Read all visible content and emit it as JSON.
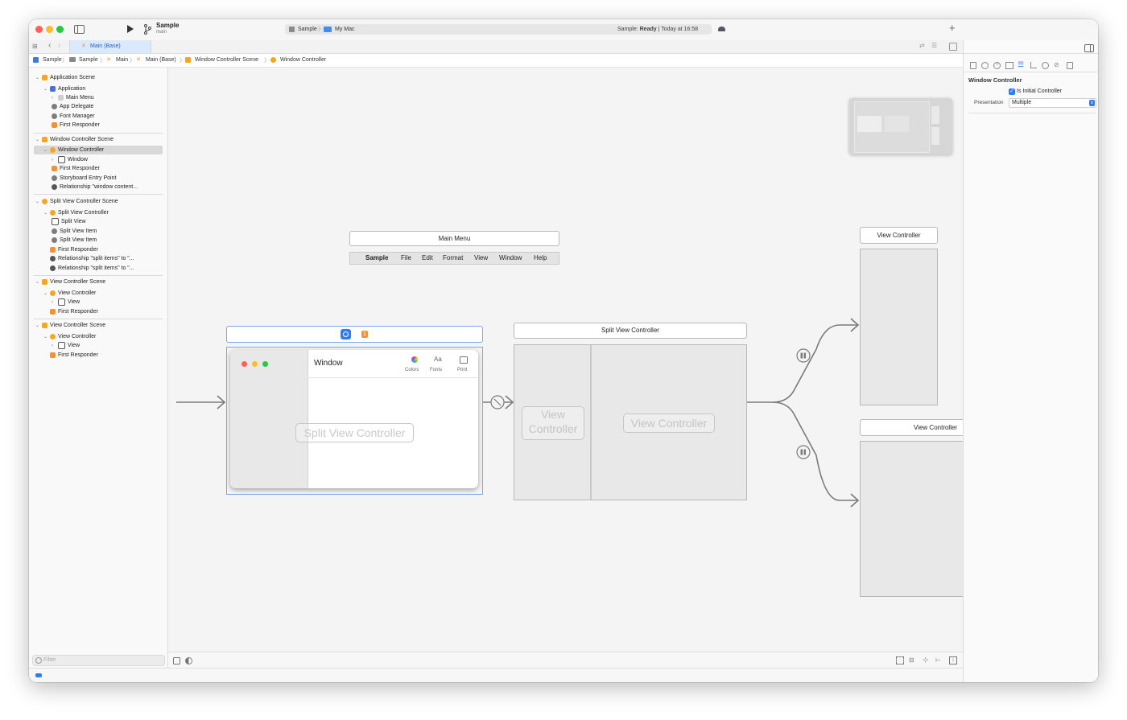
{
  "toolbar": {
    "project_name": "Sample",
    "branch": "main",
    "scheme": "Sample",
    "destination": "My Mac",
    "status_prefix": "Sample: ",
    "status_state": "Ready",
    "status_time": " | Today at 16:58"
  },
  "tabs": {
    "active_tab": "Main (Base)"
  },
  "jumpbar": [
    "Sample",
    "Sample",
    "Main",
    "Main (Base)",
    "Window Controller Scene",
    "Window Controller"
  ],
  "navigator": {
    "filter_placeholder": "Filter",
    "scenes": [
      {
        "title": "Application Scene",
        "items": [
          "Application",
          "Main Menu",
          "App Delegate",
          "Font Manager",
          "First Responder"
        ]
      },
      {
        "title": "Window Controller Scene",
        "items": [
          "Window Controller",
          "Window",
          "First Responder",
          "Storyboard Entry Point",
          "Relationship \"window content..."
        ]
      },
      {
        "title": "Split View Controller Scene",
        "items": [
          "Split View Controller",
          "Split View",
          "Split View Item",
          "Split View Item",
          "First Responder",
          "Relationship \"split items\" to \"...",
          "Relationship \"split items\" to \"..."
        ]
      },
      {
        "title": "View Controller Scene",
        "items": [
          "View Controller",
          "View",
          "First Responder"
        ]
      },
      {
        "title": "View Controller Scene",
        "items": [
          "View Controller",
          "View",
          "First Responder"
        ]
      }
    ]
  },
  "canvas": {
    "main_menu_title": "Main Menu",
    "menu_items": [
      "Sample",
      "File",
      "Edit",
      "Format",
      "View",
      "Window",
      "Help"
    ],
    "window_badge": "1",
    "window_title": "Window",
    "window_toolbar_items": [
      "Colors",
      "Fonts",
      "Print"
    ],
    "fonts_glyph": "Aa",
    "window_placeholder": "Split View Controller",
    "split_title": "Split View Controller",
    "split_left_placeholder": "View\nController",
    "split_right_placeholder": "View Controller",
    "vc_top_title": "View Controller",
    "vc_bottom_title": "View Controller"
  },
  "inspector": {
    "section_title": "Window Controller",
    "is_initial_label": "Is Initial Controller",
    "is_initial_checked": true,
    "presentation_label": "Presentation",
    "presentation_value": "Multiple"
  },
  "colors": {
    "accent": "#2f7cf6",
    "orange": "#f0923a",
    "red": "#ff5f57",
    "yellow": "#febc2e",
    "green": "#28c840"
  }
}
